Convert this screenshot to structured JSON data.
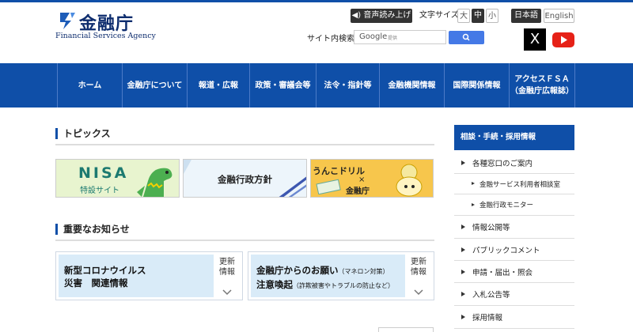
{
  "logo": {
    "jp": "金融庁",
    "en": "Financial Services Agency"
  },
  "toolbar": {
    "read_aloud": "音声読み上げ",
    "font_size_label": "文字サイズ",
    "font_sizes": [
      "大",
      "中",
      "小"
    ],
    "lang_ja": "日本語",
    "lang_en": "English"
  },
  "search": {
    "label": "サイト内検索",
    "brand": "Google",
    "provider": "提供"
  },
  "social": {
    "x": "X",
    "youtube": "YouTube"
  },
  "nav": [
    {
      "label": "ホーム"
    },
    {
      "label": "金融庁について"
    },
    {
      "label": "報道・広報"
    },
    {
      "label": "政策・審議会等"
    },
    {
      "label": "法令・指針等"
    },
    {
      "label": "金融機関情報"
    },
    {
      "label": "国際関係情報"
    },
    {
      "label": "アクセスＦＳＡ",
      "sub": "（金融庁広報誌）"
    }
  ],
  "topics": {
    "title": "トピックス",
    "banners": [
      {
        "title": "NISA",
        "sub": "特設サイト"
      },
      {
        "title": "金融行政方針"
      },
      {
        "title": "うんこドリル",
        "x": "×",
        "sub": "金融庁"
      }
    ]
  },
  "notices": {
    "title": "重要なお知らせ",
    "items": [
      {
        "line1": "新型コロナウイルス",
        "line2": "災害　関連情報",
        "side1": "更新",
        "side2": "情報"
      },
      {
        "line1": "金融庁からのお願い",
        "line1_small": "（マネロン対策）",
        "line2": "注意喚起",
        "line2_small": "（詐欺被害やトラブルの防止など）",
        "side1": "更新",
        "side2": "情報"
      }
    ]
  },
  "sidebar": {
    "title": "相談・手続・採用情報",
    "items": [
      {
        "label": "各種窓口のご案内",
        "sub": false
      },
      {
        "label": "金融サービス利用者相談室",
        "sub": true
      },
      {
        "label": "金融行政モニター",
        "sub": true
      },
      {
        "label": "情報公開等",
        "sub": false
      },
      {
        "label": "パブリックコメント",
        "sub": false
      },
      {
        "label": "申請・届出・照会",
        "sub": false
      },
      {
        "label": "入札公告等",
        "sub": false
      },
      {
        "label": "採用情報",
        "sub": false
      }
    ]
  },
  "colors": {
    "brand_blue": "#0f4fa8",
    "notice_bg": "#d9ebf8"
  }
}
